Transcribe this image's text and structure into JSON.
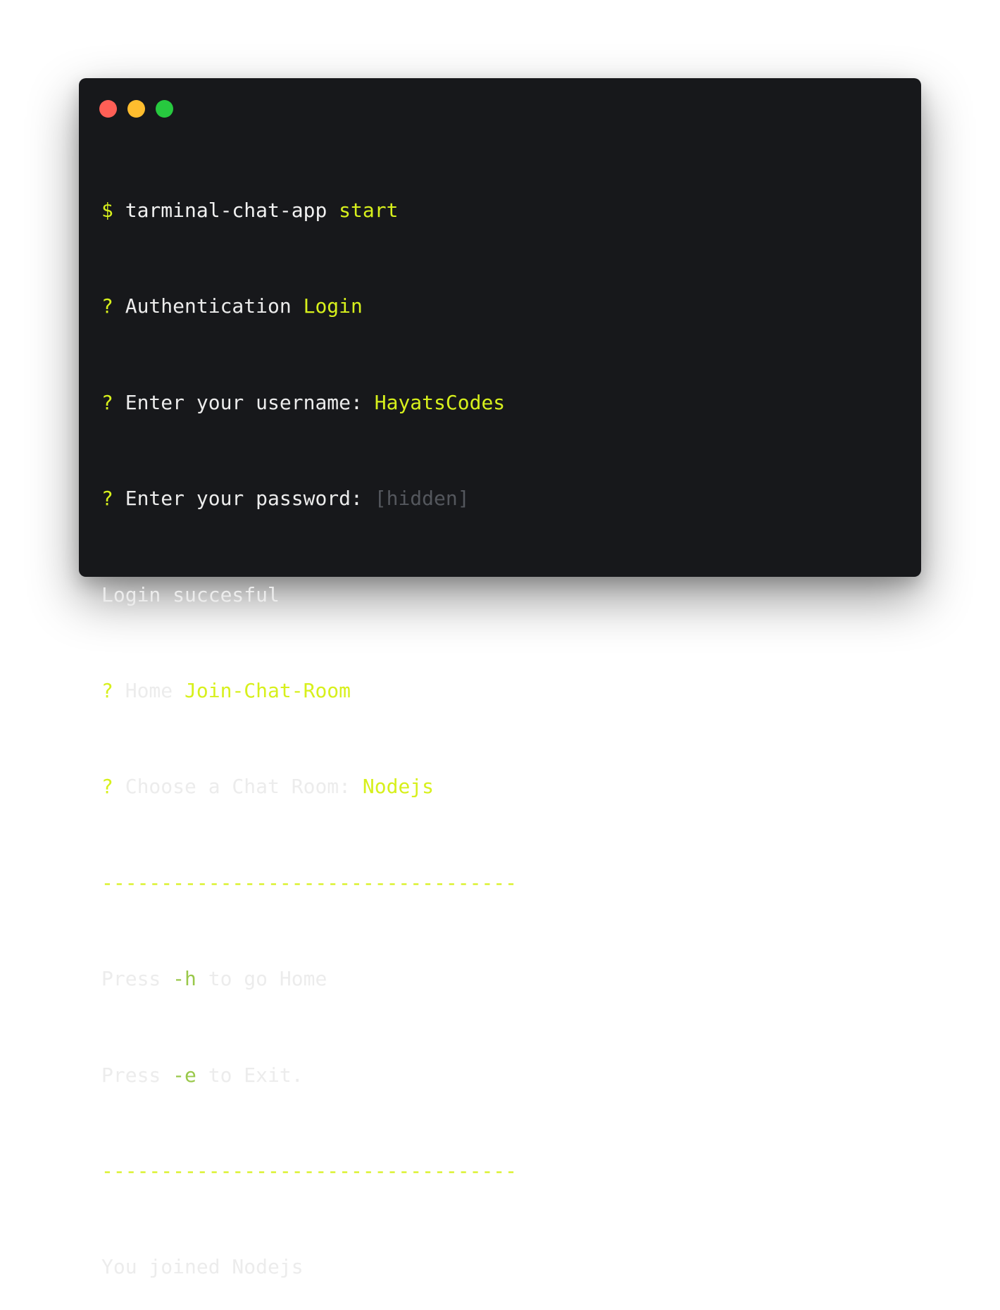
{
  "window": {
    "controls": [
      {
        "name": "close",
        "color": "#ff5f56"
      },
      {
        "name": "minimize",
        "color": "#ffbd2e"
      },
      {
        "name": "zoom",
        "color": "#27c93f"
      }
    ]
  },
  "colors": {
    "background": "#17181b",
    "text": "#ececec",
    "accent": "#d7f01c",
    "flag": "#99c84a",
    "muted": "#54575d"
  },
  "terminal": {
    "command": {
      "prompt": "$",
      "program": "tarminal-chat-app",
      "argument": "start"
    },
    "auth": {
      "marker": "?",
      "label": "Authentication",
      "value": "Login"
    },
    "username": {
      "marker": "?",
      "label": "Enter your username:",
      "value": "HayatsCodes"
    },
    "password": {
      "marker": "?",
      "label": "Enter your password:",
      "value": "[hidden]"
    },
    "login_message": "Login succesful",
    "home": {
      "marker": "?",
      "label": "Home",
      "value": "Join-Chat-Room"
    },
    "room": {
      "marker": "?",
      "label": "Choose a Chat Room:",
      "value": "Nodejs"
    },
    "divider": "-----------------------------------",
    "help_home": {
      "prefix": "Press",
      "flag": "-h",
      "suffix": "to go Home"
    },
    "help_exit": {
      "prefix": "Press",
      "flag": "-e",
      "suffix": "to Exit."
    },
    "joined_message": "You joined Nodejs"
  }
}
